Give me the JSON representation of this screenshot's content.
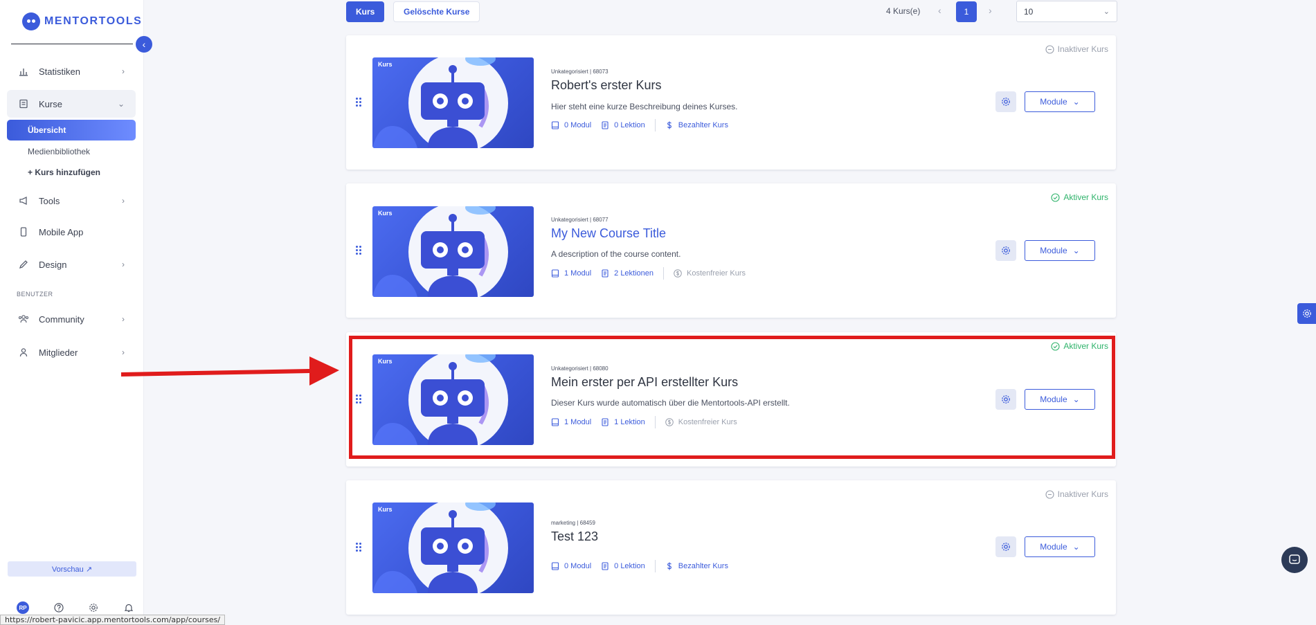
{
  "sidebar": {
    "logo_text": "MENTORTOOLS",
    "items": [
      {
        "label": "Statistiken"
      },
      {
        "label": "Kurse"
      },
      {
        "label": "Tools"
      },
      {
        "label": "Mobile App"
      },
      {
        "label": "Design"
      },
      {
        "label": "Community"
      },
      {
        "label": "Mitglieder"
      }
    ],
    "subitems": [
      {
        "label": "Übersicht"
      },
      {
        "label": "Medienbibliothek"
      },
      {
        "label": "+ Kurs hinzufügen"
      }
    ],
    "section_label": "BENUTZER",
    "preview_label": "Vorschau ↗",
    "avatar_initials": "RP"
  },
  "toolbar": {
    "tab_kurs": "Kurs",
    "tab_deleted": "Gelöschte Kurse",
    "course_count": "4 Kurs(e)",
    "prev": "‹",
    "current_page": "1",
    "next": "›",
    "per_page": "10"
  },
  "courses": [
    {
      "badge": "Kurs",
      "meta": "Unkategorisiert | 68073",
      "title": "Robert's erster Kurs",
      "description": "Hier steht eine kurze Beschreibung deines Kurses.",
      "modules": "0 Modul",
      "lessons": "0 Lektion",
      "price": "Bezahlter Kurs",
      "status": "Inaktiver Kurs",
      "module_button": "Module"
    },
    {
      "badge": "Kurs",
      "meta": "Unkategorisiert | 68077",
      "title": "My New Course Title",
      "description": "A description of the course content.",
      "modules": "1 Modul",
      "lessons": "2 Lektionen",
      "price": "Kostenfreier Kurs",
      "status": "Aktiver Kurs",
      "module_button": "Module"
    },
    {
      "badge": "Kurs",
      "meta": "Unkategorisiert | 68080",
      "title": "Mein erster per API erstellter Kurs",
      "description": "Dieser Kurs wurde automatisch über die Mentortools-API erstellt.",
      "modules": "1 Modul",
      "lessons": "1 Lektion",
      "price": "Kostenfreier Kurs",
      "status": "Aktiver Kurs",
      "module_button": "Module"
    },
    {
      "badge": "Kurs",
      "meta": "marketing | 68459",
      "title": "Test 123",
      "description": "",
      "modules": "0 Modul",
      "lessons": "0 Lektion",
      "price": "Bezahlter Kurs",
      "status": "Inaktiver Kurs",
      "module_button": "Module"
    }
  ],
  "status_bar_url": "https://robert-pavicic.app.mentortools.com/app/courses/",
  "colors": {
    "accent": "#3b5bdb",
    "active_status": "#2fb36b",
    "inactive_status": "#9aa0ad",
    "highlight": "#e01c1c"
  }
}
